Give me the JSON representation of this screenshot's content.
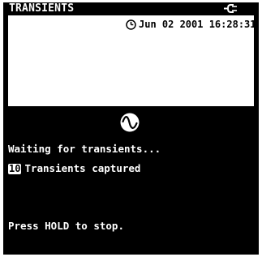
{
  "header": {
    "title": "TRANSIENTS",
    "status_icon": "power-plug-icon"
  },
  "panel": {
    "clock_icon": "clock-icon",
    "datetime": "Jun 02 2001 16:28:31"
  },
  "status": {
    "mode_icon": "waveform-icon",
    "waiting_text": "Waiting for transients...",
    "captured_count": "10",
    "captured_label": "Transients captured"
  },
  "footer": {
    "hint": "Press HOLD to stop."
  },
  "colors": {
    "background": "#000000",
    "foreground": "#ffffff"
  }
}
